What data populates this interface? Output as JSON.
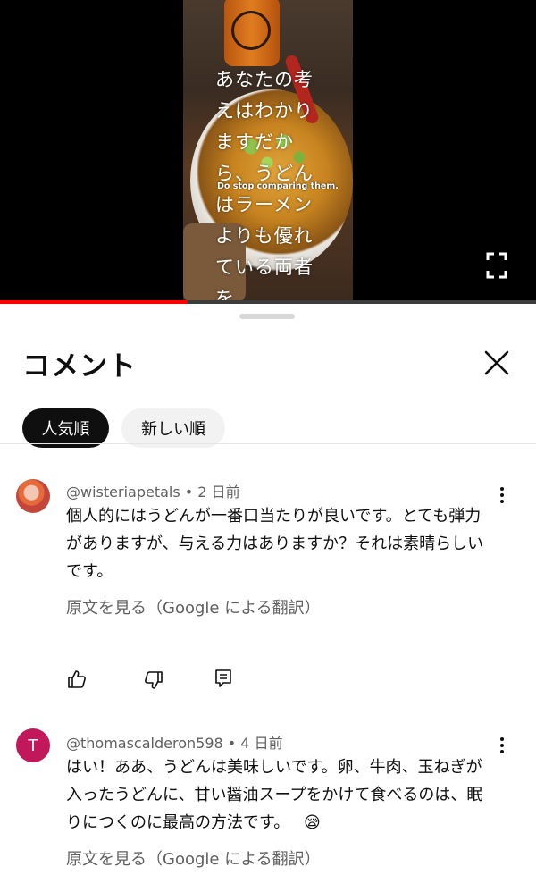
{
  "video": {
    "subtitle_jp": "あなたの考えはわかりますだから、うどんはラーメンよりも優れている両者を",
    "subtitle_en": "Do stop comparing them.",
    "progress": 0.35
  },
  "comments_sheet": {
    "title": "コメント",
    "sort_chips": [
      "人気順",
      "新しい順"
    ]
  },
  "comments": [
    {
      "author": "@wisteriapetals",
      "age": "2 日前",
      "text": "個人的にはうどんが一番口当たりが良いです。とても弾力がありますが、与える力はありますか？それは素晴らしいです。",
      "translate_label": "原文を見る（Google による翻訳）"
    },
    {
      "author": "@thomascalderon598",
      "age": "4 日前",
      "avatar_letter": "T",
      "text": "はい！ああ、うどんは美味しいです。卵、牛肉、玉ねぎが入ったうどんに、甘い醤油スープをかけて食べるのは、眠りにつくのに最高の方法です。",
      "emoji": "😪",
      "translate_label": "原文を見る（Google による翻訳）"
    }
  ],
  "icons": {
    "like": "thumbs-up-icon",
    "dislike": "thumbs-down-icon",
    "reply": "reply-icon",
    "more": "more-vert-icon",
    "close": "close-icon",
    "fullscreen": "fullscreen-icon"
  }
}
